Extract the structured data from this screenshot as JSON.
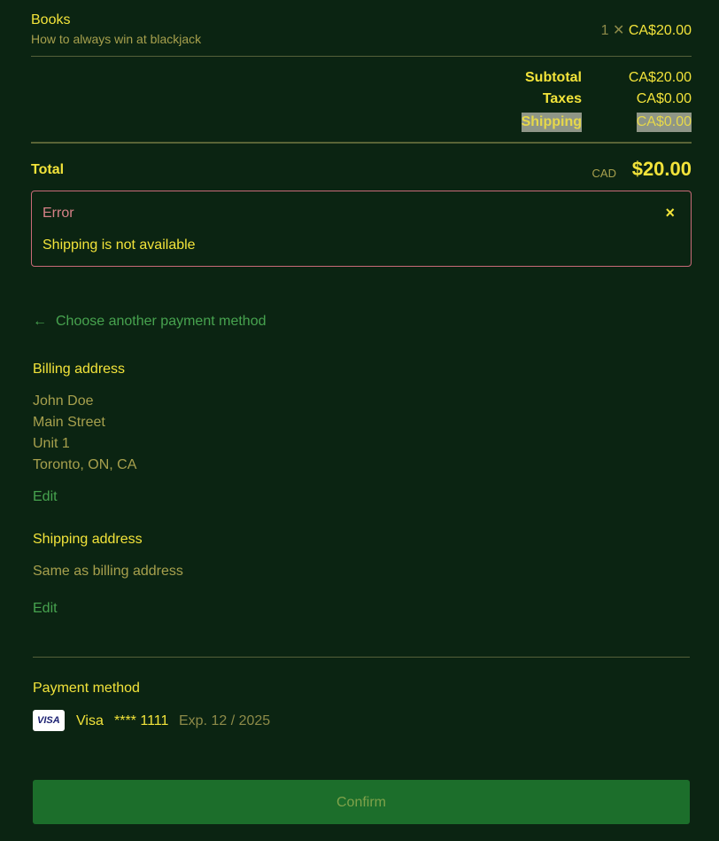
{
  "line_item": {
    "name": "Books",
    "description": "How to always win at blackjack",
    "quantity": "1 ✕",
    "price": "CA$20.00"
  },
  "summary": {
    "subtotal_label": "Subtotal",
    "subtotal_value": "CA$20.00",
    "taxes_label": "Taxes",
    "taxes_value": "CA$0.00",
    "shipping_label": "Shipping",
    "shipping_value": "CA$0.00"
  },
  "total": {
    "label": "Total",
    "currency": "CAD",
    "value": "$20.00"
  },
  "error": {
    "title": "Error",
    "message": "Shipping is not available",
    "close_icon": "×"
  },
  "back_link": {
    "label": "Choose another payment method",
    "icon": "←"
  },
  "billing": {
    "title": "Billing address",
    "lines": [
      "John Doe",
      "Main Street",
      "Unit 1",
      "Toronto, ON, CA"
    ],
    "edit_label": "Edit"
  },
  "shipping": {
    "title": "Shipping address",
    "text": "Same as billing address",
    "edit_label": "Edit"
  },
  "payment": {
    "title": "Payment method",
    "logo_text": "VISA",
    "brand": "Visa",
    "digits": "**** 1111",
    "expiry": "Exp. 12 / 2025"
  },
  "confirm_label": "Confirm",
  "colors": {
    "background": "#0b2412",
    "accent_yellow": "#f2e33a",
    "link_green": "#47a34f",
    "error_border": "#c86a78",
    "button_green": "#1c6e2b"
  }
}
